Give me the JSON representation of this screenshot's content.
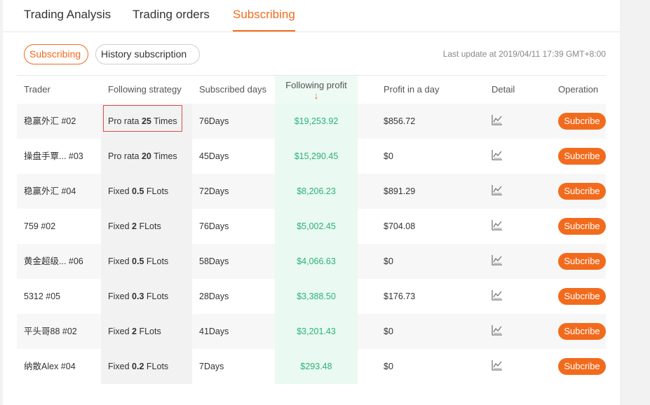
{
  "tabs": [
    {
      "label": "Trading Analysis"
    },
    {
      "label": "Trading orders"
    },
    {
      "label": "Subscribing"
    }
  ],
  "subtabs": {
    "active": "Subscribing",
    "inactive": "History subscription"
  },
  "last_update": "Last update at 2019/04/11 17:39 GMT+8:00",
  "columns": {
    "trader": "Trader",
    "strategy": "Following strategy",
    "days": "Subscribed days",
    "profit": "Following profit",
    "profit_day": "Profit in a day",
    "detail": "Detail",
    "operation": "Operation"
  },
  "sort_icon": "↓",
  "rows": [
    {
      "trader": "稳赢外汇 #02",
      "strategy_prefix": "Pro rata ",
      "strategy_value": "25",
      "strategy_suffix": " Times",
      "days": "76Days",
      "profit": "$19,253.92",
      "profit_day": "$856.72",
      "button": "Subcribe"
    },
    {
      "trader": "操盘手覃... #03",
      "strategy_prefix": "Pro rata ",
      "strategy_value": "20",
      "strategy_suffix": " Times",
      "days": "45Days",
      "profit": "$15,290.45",
      "profit_day": "$0",
      "button": "Subcribe"
    },
    {
      "trader": "稳赢外汇 #04",
      "strategy_prefix": "Fixed ",
      "strategy_value": "0.5",
      "strategy_suffix": " FLots",
      "days": "72Days",
      "profit": "$8,206.23",
      "profit_day": "$891.29",
      "button": "Subcribe"
    },
    {
      "trader": "759 #02",
      "strategy_prefix": "Fixed ",
      "strategy_value": "2",
      "strategy_suffix": " FLots",
      "days": "76Days",
      "profit": "$5,002.45",
      "profit_day": "$704.08",
      "button": "Subcribe"
    },
    {
      "trader": "黄金超级... #06",
      "strategy_prefix": "Fixed ",
      "strategy_value": "0.5",
      "strategy_suffix": " FLots",
      "days": "58Days",
      "profit": "$4,066.63",
      "profit_day": "$0",
      "button": "Subcribe"
    },
    {
      "trader": "5312 #05",
      "strategy_prefix": "Fixed ",
      "strategy_value": "0.3",
      "strategy_suffix": " FLots",
      "days": "28Days",
      "profit": "$3,388.50",
      "profit_day": "$176.73",
      "button": "Subcribe"
    },
    {
      "trader": "平头哥88 #02",
      "strategy_prefix": "Fixed ",
      "strategy_value": "2",
      "strategy_suffix": " FLots",
      "days": "41Days",
      "profit": "$3,201.43",
      "profit_day": "$0",
      "button": "Subcribe"
    },
    {
      "trader": "纳散Alex #04",
      "strategy_prefix": "Fixed ",
      "strategy_value": "0.2",
      "strategy_suffix": " FLots",
      "days": "7Days",
      "profit": "$293.48",
      "profit_day": "$0",
      "button": "Subcribe"
    }
  ],
  "colors": {
    "accent": "#f26b1d",
    "profit": "#2bb27a",
    "highlight_border": "#e04b4b"
  },
  "icons": {
    "detail": "line-chart-icon",
    "sort": "sort-down-arrow-icon"
  }
}
